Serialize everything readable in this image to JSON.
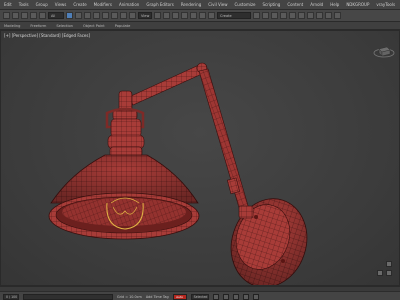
{
  "menu": [
    "Edit",
    "Tools",
    "Group",
    "Views",
    "Create",
    "Modifiers",
    "Animation",
    "Graph Editors",
    "Rendering",
    "Civil View",
    "Customize",
    "Scripting",
    "Content",
    "Arnold",
    "Help",
    "NDKGROUP",
    "vrayTools"
  ],
  "toolbar": {
    "selection_filter": "All",
    "view_mode": "View",
    "named_set": "Create Selection Se"
  },
  "ribbon": [
    "Modeling",
    "Freeform",
    "Selection",
    "Object Paint",
    "Populate"
  ],
  "viewport": {
    "label": "[+] [Perspective] [Standard] [Edged Faces]"
  },
  "status": {
    "frame": "0 / 100",
    "grid": "Grid = 10.0cm",
    "add_time_tag": "Add Time Tag",
    "auto_label": "Auto",
    "selected": "Selected"
  },
  "colors": {
    "model": "#a83c38",
    "wire": "#3a0f0e",
    "accent": "#4f7fb8"
  }
}
